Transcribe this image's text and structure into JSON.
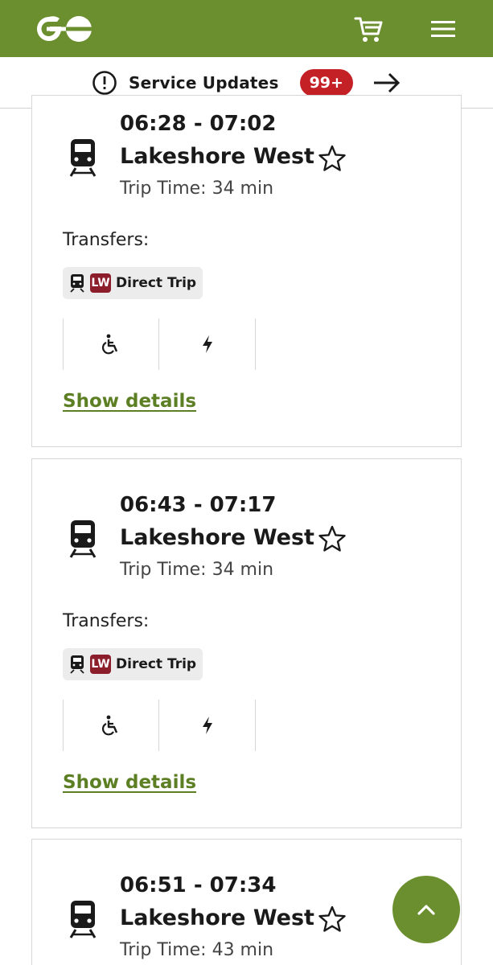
{
  "header": {
    "logo_icon": "go-logo",
    "cart_icon": "cart-icon",
    "menu_icon": "hamburger-menu-icon",
    "brand_color": "#6b8f2e"
  },
  "service_updates": {
    "label": "Service Updates",
    "count": "99+",
    "badge_color": "#c42127"
  },
  "trips": [
    {
      "time": "06:28 - 07:02",
      "line": "Lakeshore West",
      "trip_time": "Trip Time: 34 min",
      "transfers_label": "Transfers:",
      "route_code": "LW",
      "route_text": "Direct Trip",
      "details_label": "Show details"
    },
    {
      "time": "06:43 - 07:17",
      "line": "Lakeshore West",
      "trip_time": "Trip Time: 34 min",
      "transfers_label": "Transfers:",
      "route_code": "LW",
      "route_text": "Direct Trip",
      "details_label": "Show details"
    },
    {
      "time": "06:51 - 07:34",
      "line": "Lakeshore West",
      "trip_time": "Trip Time: 43 min"
    }
  ]
}
